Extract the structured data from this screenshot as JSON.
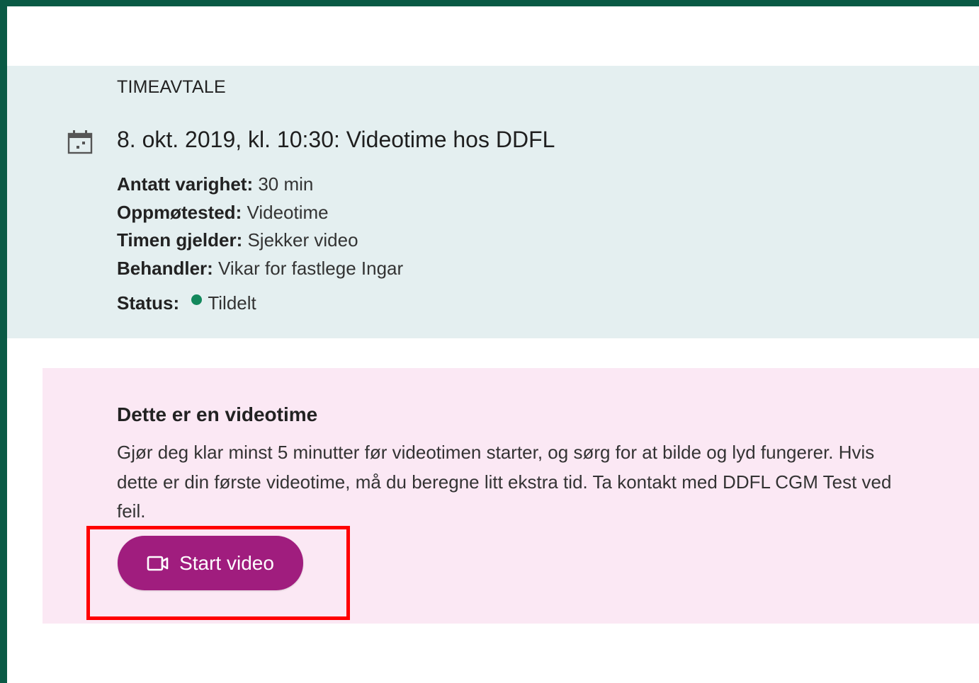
{
  "appointment": {
    "section_label": "TIMEAVTALE",
    "icon": "calendar-icon",
    "title": "8. okt. 2019, kl. 10:30: Videotime hos DDFL",
    "details": [
      {
        "label": "Antatt varighet:",
        "value": " 30 min"
      },
      {
        "label": "Oppmøtested:",
        "value": " Videotime"
      },
      {
        "label": "Timen gjelder:",
        "value": " Sjekker video"
      },
      {
        "label": "Behandler:",
        "value": " Vikar for fastlege Ingar"
      }
    ],
    "status": {
      "label": "Status:",
      "value": "Tildelt",
      "color": "#12885c"
    }
  },
  "video": {
    "heading": "Dette er en videotime",
    "text": "Gjør deg klar minst 5 minutter før videotimen starter, og sørg for at bilde og lyd fungerer. Hvis dette er din første videotime, må du beregne litt ekstra tid. Ta kontakt med DDFL CGM Test ved feil.",
    "button": {
      "label": "Start video",
      "icon": "video-camera-icon",
      "color": "#a01d7e"
    }
  },
  "colors": {
    "frame": "#0a5a45",
    "appointment_bg": "#e4eff0",
    "video_bg": "#fbe8f4",
    "highlight": "#ff0000"
  }
}
